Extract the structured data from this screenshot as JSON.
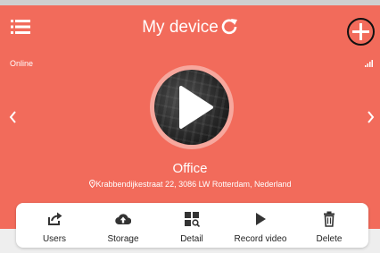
{
  "header": {
    "title": "My device"
  },
  "status": {
    "connection": "Online"
  },
  "device": {
    "name": "Office",
    "address": "Krabbendijkestraat 22, 3086 LW Rotterdam, Nederland"
  },
  "toolbar": {
    "items": [
      {
        "label": "Users",
        "icon": "share-icon"
      },
      {
        "label": "Storage",
        "icon": "cloud-upload-icon"
      },
      {
        "label": "Detail",
        "icon": "detail-grid-icon"
      },
      {
        "label": "Record video",
        "icon": "play-icon"
      },
      {
        "label": "Delete",
        "icon": "trash-icon"
      }
    ]
  },
  "colors": {
    "accent": "#f26b5b",
    "background": "#eeeeee",
    "toolbar": "#ffffff"
  }
}
